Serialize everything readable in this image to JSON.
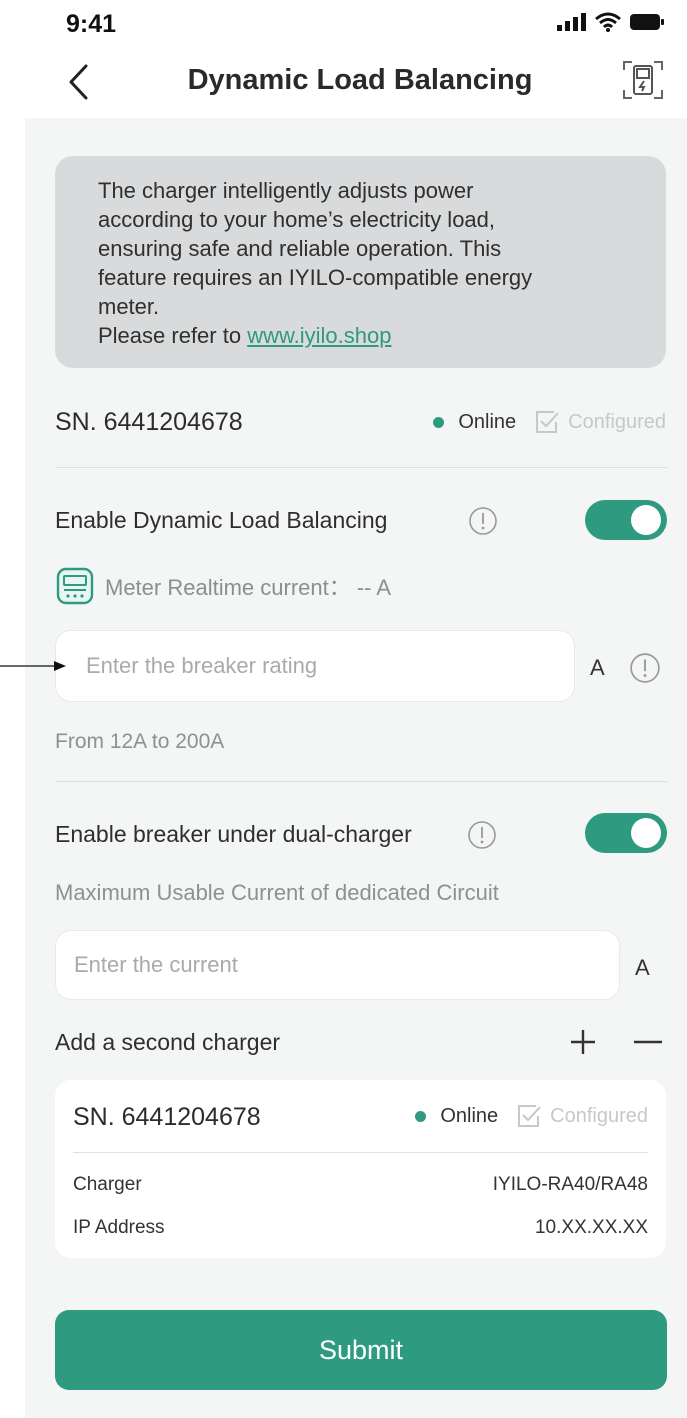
{
  "status_bar": {
    "time": "9:41"
  },
  "header": {
    "title": "Dynamic Load Balancing"
  },
  "notice": {
    "line1": "The charger intelligently adjusts power",
    "line2": "according to your home’s electricity load,",
    "line3": "ensuring safe and reliable operation. This",
    "line4": "feature requires an IYILO-compatible energy",
    "line5": "meter.",
    "refer_prefix": "Please refer to ",
    "link": "www.iyilo.shop"
  },
  "device": {
    "sn": "SN. 6441204678",
    "online": "Online",
    "configured": "Configured"
  },
  "dlb": {
    "label": "Enable Dynamic Load Balancing",
    "enabled": true,
    "meter_label": "Meter Realtime current： -- A",
    "breaker_placeholder": "Enter the breaker rating",
    "unit": "A",
    "range_hint": "From 12A  to  200A"
  },
  "dual": {
    "label": "Enable breaker under dual-charger",
    "enabled": true,
    "max_current_label": "Maximum Usable Current of dedicated Circuit",
    "current_placeholder": "Enter the current",
    "unit": "A"
  },
  "second_charger": {
    "label": "Add a second charger",
    "plus": "+",
    "minus": "—"
  },
  "card": {
    "sn": "SN. 6441204678",
    "online": "Online",
    "configured": "Configured",
    "charger_label": "Charger",
    "charger_value": "IYILO-RA40/RA48",
    "ip_label": "IP Address",
    "ip_value": "10.XX.XX.XX"
  },
  "submit_label": "Submit",
  "colors": {
    "accent": "#2e9a7f",
    "notice_bg": "#d9dadb",
    "content_bg": "#f4f6f5"
  },
  "icons": [
    "back-arrow-icon",
    "scan-charger-icon",
    "signal-icon",
    "wifi-icon",
    "battery-icon",
    "info-icon",
    "meter-icon",
    "check-square-icon"
  ]
}
